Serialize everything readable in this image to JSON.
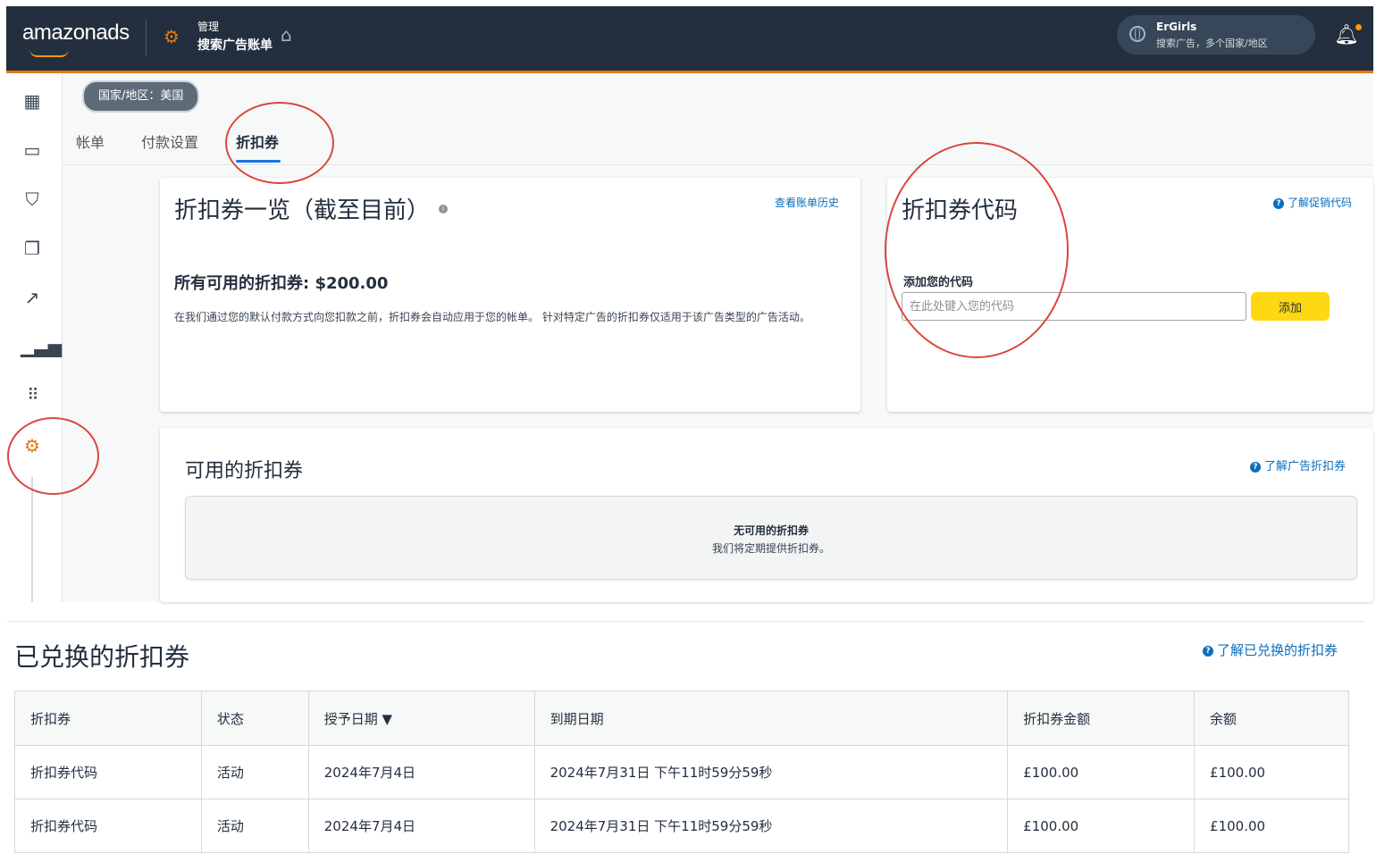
{
  "header": {
    "brand": "amazonads",
    "manage_label": "管理",
    "account_type": "搜索广告账单",
    "account_name": "ErGirls",
    "account_sub": "搜索广告，多个国家/地区"
  },
  "country_pill": "国家/地区：美国",
  "tabs": [
    {
      "label": "帐单"
    },
    {
      "label": "付款设置"
    },
    {
      "label": "折扣券"
    }
  ],
  "overview": {
    "title": "折扣券一览（截至目前）",
    "history_link": "查看账单历史",
    "total_label": "所有可用的折扣券: $200.00",
    "description": "在我们通过您的默认付款方式向您扣款之前，折扣券会自动应用于您的帐单。 针对特定广告的折扣券仅适用于该广告类型的广告活动。"
  },
  "code_card": {
    "title": "折扣券代码",
    "learn_link": "了解促销代码",
    "add_label": "添加您的代码",
    "input_placeholder": "在此处键入您的代码",
    "add_button": "添加"
  },
  "available": {
    "title": "可用的折扣券",
    "learn_link": "了解广告折扣券",
    "empty_title": "无可用的折扣券",
    "empty_sub": "我们将定期提供折扣券。"
  },
  "redeemed": {
    "title": "已兑换的折扣券",
    "learn_link": "了解已兑换的折扣券",
    "columns": [
      "折扣券",
      "状态",
      "授予日期 ▼",
      "到期日期",
      "折扣券金额",
      "余额"
    ],
    "rows": [
      [
        "折扣券代码",
        "活动",
        "2024年7月4日",
        "2024年7月31日 下午11时59分59秒",
        "£100.00",
        "£100.00"
      ],
      [
        "折扣券代码",
        "活动",
        "2024年7月4日",
        "2024年7月31日 下午11时59分59秒",
        "£100.00",
        "£100.00"
      ]
    ]
  },
  "colors": {
    "header_bg": "#232f3e",
    "accent_orange": "#e47911",
    "link_blue": "#0a6ebd",
    "button_yellow": "#ffd814",
    "annotation_red": "#d9463e"
  }
}
